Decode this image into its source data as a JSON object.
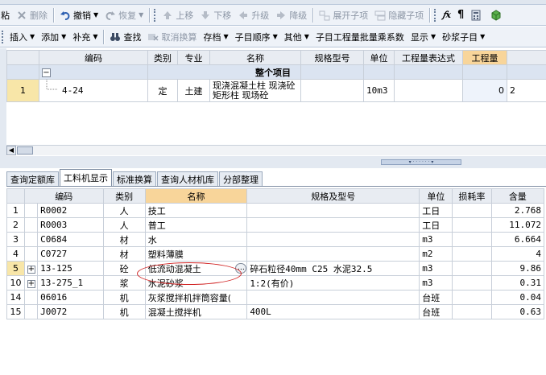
{
  "toolbar1": {
    "items": [
      {
        "label": "粘",
        "icon": "paste-icon",
        "disabled": false
      },
      {
        "label": "删除",
        "icon": "delete-icon",
        "disabled": true
      },
      {
        "label": "撤销",
        "icon": "undo-icon",
        "disabled": false,
        "dropdown": true
      },
      {
        "label": "恢复",
        "icon": "redo-icon",
        "disabled": true,
        "dropdown": true
      },
      {
        "label": "上移",
        "icon": "move-up-icon",
        "disabled": true
      },
      {
        "label": "下移",
        "icon": "move-down-icon",
        "disabled": true
      },
      {
        "label": "升级",
        "icon": "promote-icon",
        "disabled": true
      },
      {
        "label": "降级",
        "icon": "demote-icon",
        "disabled": true
      },
      {
        "label": "展开子项",
        "icon": "expand-children-icon",
        "disabled": true
      },
      {
        "label": "隐藏子项",
        "icon": "hide-children-icon",
        "disabled": true
      }
    ],
    "right_icons": [
      {
        "glyph": "𝑓x",
        "icon": "formula-icon"
      },
      {
        "glyph": "¶",
        "icon": "paragraph-icon"
      },
      {
        "glyph": "",
        "icon": "calculator-icon"
      },
      {
        "glyph": "",
        "icon": "cube-icon"
      }
    ]
  },
  "toolbar2": {
    "items": [
      {
        "label": "插入",
        "dropdown": true
      },
      {
        "label": "添加",
        "dropdown": true
      },
      {
        "label": "补充",
        "dropdown": true
      },
      {
        "label": "查找",
        "icon": "binoculars-icon"
      },
      {
        "label": "取消换算",
        "icon": "cancel-convert-icon",
        "disabled": true
      },
      {
        "label": "存档",
        "dropdown": true
      },
      {
        "label": "子目顺序",
        "dropdown": true
      },
      {
        "label": "其他",
        "dropdown": true
      },
      {
        "label": "子目工程量批量乘系数"
      },
      {
        "label": "显示",
        "dropdown": true
      },
      {
        "label": "砂浆子目",
        "dropdown": true
      }
    ]
  },
  "upper_table": {
    "columns": [
      "编码",
      "类别",
      "专业",
      "名称",
      "规格型号",
      "单位",
      "工程量表达式",
      "工程量"
    ],
    "group_toggle": "−",
    "group_label": "整个项目",
    "row": {
      "num": "1",
      "code": "4-24",
      "type": "定",
      "major": "土建",
      "name_line1": "现浇混凝土柱 现浇砼",
      "name_line2": "矩形柱 现场砼",
      "unit": "10m3",
      "expr": "",
      "qty": "0",
      "overflow": "2"
    }
  },
  "tabs": [
    "查询定额库",
    "工料机显示",
    "标准换算",
    "查询人材机库",
    "分部整理"
  ],
  "active_tab": 1,
  "lower_table": {
    "columns": [
      "编码",
      "类别",
      "名称",
      "规格及型号",
      "单位",
      "损耗率",
      "含量"
    ],
    "rows": [
      {
        "num": "1",
        "expand": "",
        "code": "R0002",
        "type": "人",
        "name": "技工",
        "spec": "",
        "unit": "工日",
        "loss": "",
        "qty": "2.768"
      },
      {
        "num": "2",
        "expand": "",
        "code": "R0003",
        "type": "人",
        "name": "普工",
        "spec": "",
        "unit": "工日",
        "loss": "",
        "qty": "11.072"
      },
      {
        "num": "3",
        "expand": "",
        "code": "C0684",
        "type": "材",
        "name": "水",
        "spec": "",
        "unit": "m3",
        "loss": "",
        "qty": "6.664"
      },
      {
        "num": "4",
        "expand": "",
        "code": "C0727",
        "type": "材",
        "name": "塑料薄膜",
        "spec": "",
        "unit": "m2",
        "loss": "",
        "qty": "4"
      },
      {
        "num": "5",
        "expand": "+",
        "code": "13-125",
        "type": "砼",
        "name": "低流动混凝土",
        "spec": "碎石粒径40mm C25 水泥32.5",
        "unit": "m3",
        "loss": "",
        "qty": "9.86"
      },
      {
        "num": "10",
        "expand": "+",
        "code": "13-275_1",
        "type": "浆",
        "name": "水泥砂浆",
        "spec": "1:2(有价)",
        "unit": "m3",
        "loss": "",
        "qty": "0.31"
      },
      {
        "num": "14",
        "expand": "",
        "code": "06016",
        "type": "机",
        "name": "灰浆搅拌机拌筒容量(",
        "spec": "",
        "unit": "台班",
        "loss": "",
        "qty": "0.04"
      },
      {
        "num": "15",
        "expand": "",
        "code": "J0072",
        "type": "机",
        "name": "混凝土搅拌机",
        "spec": "400L",
        "unit": "台班",
        "loss": "",
        "qty": "0.63"
      }
    ],
    "ellipsis_button": "…"
  },
  "colors": {
    "header_active": "#f8d59a",
    "row_highlight": "#f8e6a8",
    "qty_cell": "#eef3fb",
    "annotation": "#d02020",
    "group_row": "#dbe4f1"
  }
}
